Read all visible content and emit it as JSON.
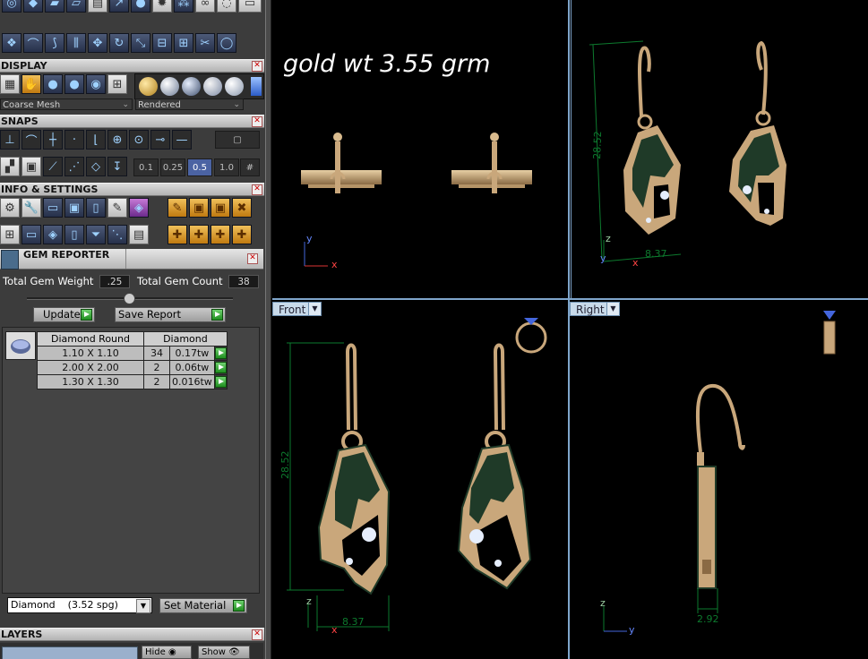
{
  "display": {
    "title": "DISPLAY",
    "mesh_dropdown": "Coarse Mesh",
    "render_dropdown": "Rendered"
  },
  "snaps": {
    "title": "SNAPS",
    "values": [
      "0.1",
      "0.25",
      "0.5",
      "1.0"
    ]
  },
  "info_settings": {
    "title": "INFO & SETTINGS"
  },
  "gem_reporter": {
    "title": "GEM REPORTER",
    "total_weight_label": "Total Gem Weight",
    "total_weight_value": ".25",
    "total_count_label": "Total Gem Count",
    "total_count_value": "38",
    "update_label": "Update",
    "save_report_label": "Save Report",
    "table": {
      "headers": [
        "Diamond Round",
        "Diamond"
      ],
      "rows": [
        {
          "size": "1.10 X 1.10",
          "count": "34",
          "tw": "0.17tw"
        },
        {
          "size": "2.00 X 2.00",
          "count": "2",
          "tw": "0.06tw"
        },
        {
          "size": "1.30 X 1.30",
          "count": "2",
          "tw": "0.016tw"
        }
      ]
    },
    "material_dropdown": "Diamond    (3.52 spg)",
    "set_material_label": "Set Material"
  },
  "layers": {
    "title": "LAYERS",
    "hide_label": "Hide",
    "show_label": "Show"
  },
  "viewports": {
    "top_left": {
      "headline": "gold wt 3.55 grm",
      "axis_y": "y",
      "axis_x": "x"
    },
    "top_right": {
      "dim_height": "28.52",
      "dim_width": "8.37",
      "axis_z": "z",
      "axis_y": "y",
      "axis_x": "x"
    },
    "front": {
      "label": "Front",
      "dim_height": "28.52",
      "dim_width": "8.37",
      "axis_z": "z",
      "axis_x": "x"
    },
    "right": {
      "label": "Right",
      "dim_width": "2.92",
      "axis_z": "z",
      "axis_y": "y"
    }
  },
  "colors": {
    "gold": "#c9a77b",
    "gold_dark": "#8a6a44",
    "enamel": "#1f3a28",
    "dimension": "#0d7a2e",
    "viewport_border": "#7fa6cc"
  }
}
